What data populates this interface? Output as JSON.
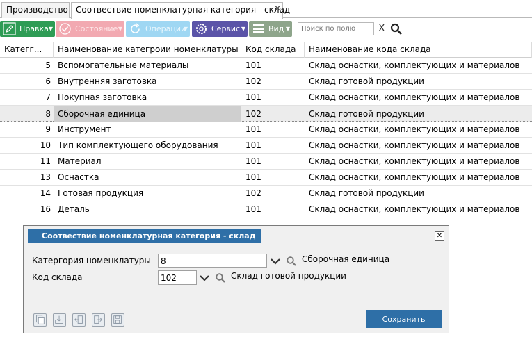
{
  "tabs": [
    {
      "label": "Производство"
    },
    {
      "label": "Соотвествие номенклатурная категория - склад"
    }
  ],
  "toolbar": {
    "pravka": "Правка",
    "sostoyanie": "Состояние",
    "operacii": "Операции",
    "servis": "Сервис",
    "vid": "Вид",
    "search_placeholder": "Поиск по полю",
    "clear": "X"
  },
  "grid": {
    "headers": [
      "Категг...",
      "Наименование категроии номенклатуры",
      "Код склада",
      "Наименование кода склада"
    ],
    "rows": [
      {
        "id": "5",
        "name": "Вспомогательные материалы",
        "code": "101",
        "wh": "Склад оснастки, комплектующих и материалов"
      },
      {
        "id": "6",
        "name": "Внутренняя заготовка",
        "code": "102",
        "wh": "Склад готовой продукции"
      },
      {
        "id": "7",
        "name": "Покупная заготовка",
        "code": "101",
        "wh": "Склад оснастки, комплектующих и материалов"
      },
      {
        "id": "8",
        "name": "Сборочная единица",
        "code": "102",
        "wh": "Склад готовой продукции"
      },
      {
        "id": "9",
        "name": "Инструмент",
        "code": "101",
        "wh": "Склад оснастки, комплектующих и материалов"
      },
      {
        "id": "10",
        "name": "Тип комплектующего оборудования",
        "code": "101",
        "wh": "Склад оснастки, комплектующих и материалов"
      },
      {
        "id": "11",
        "name": "Материал",
        "code": "101",
        "wh": "Склад оснастки, комплектующих и материалов"
      },
      {
        "id": "13",
        "name": "Оснастка",
        "code": "101",
        "wh": "Склад оснастки, комплектующих и материалов"
      },
      {
        "id": "14",
        "name": "Готовая продукция",
        "code": "102",
        "wh": "Склад готовой продукции"
      },
      {
        "id": "16",
        "name": "Деталь",
        "code": "101",
        "wh": "Склад оснастки, комплектующих и материалов"
      }
    ]
  },
  "dialog": {
    "title": "Соотвествие номенклатурная категория - склад",
    "close": "✕",
    "category_label": "Катергория номенклатуры",
    "category_value": "8",
    "category_name": "Сборочная единица",
    "warehouse_label": "Код склада",
    "warehouse_value": "102",
    "warehouse_name": "Склад готовой продукции",
    "save": "Сохранить"
  },
  "colors": {
    "pravka": "#2e9c55",
    "sostoyanie": "#f2a9b1",
    "operacii": "#9fd7f3",
    "servis": "#5b54a8",
    "vid": "#8ea58b",
    "dialog_accent": "#2e6fa7"
  }
}
